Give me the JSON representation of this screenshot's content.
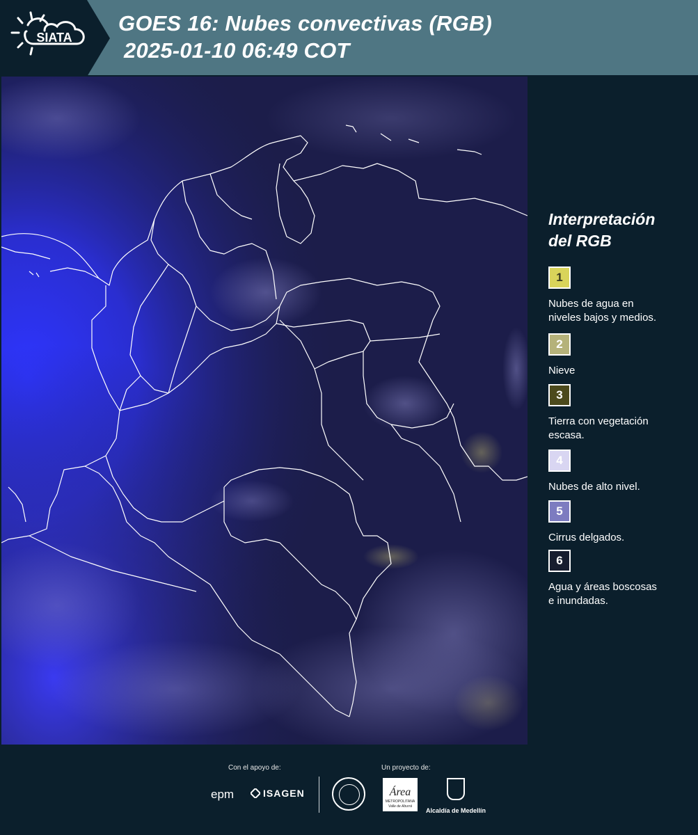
{
  "header": {
    "logo_text": "SIATA",
    "title_line1": "GOES 16: Nubes convectivas (RGB)",
    "title_line2": "2025-01-10 06:49 COT",
    "band_color": "#4f7683",
    "logo_bg_color": "#0b1f2c"
  },
  "legend": {
    "title_line1": "Interpretación",
    "title_line2": "del RGB",
    "items": [
      {
        "number": "1",
        "label_line1": "Nubes de agua en",
        "label_line2": "niveles bajos y medios.",
        "color": "#d9d45a",
        "text_color": "#3a3a20"
      },
      {
        "number": "2",
        "label_line1": "Nieve",
        "label_line2": "",
        "color": "#b5b27a",
        "text_color": "#ffffff"
      },
      {
        "number": "3",
        "label_line1": "Tierra con vegetación",
        "label_line2": "escasa.",
        "color": "#4c4a1c",
        "text_color": "#ffffff"
      },
      {
        "number": "4",
        "label_line1": "Nubes de alto nivel.",
        "label_line2": "",
        "color": "#d9d6f2",
        "text_color": "#ffffff"
      },
      {
        "number": "5",
        "label_line1": "Cirrus delgados.",
        "label_line2": "",
        "color": "#7d7cc0",
        "text_color": "#ffffff"
      },
      {
        "number": "6",
        "label_line1": "Agua y áreas boscosas",
        "label_line2": "e inundadas.",
        "color": "#171d2f",
        "text_color": "#ffffff"
      }
    ]
  },
  "footer": {
    "support_caption": "Con el apoyo de:",
    "project_caption": "Un proyecto de:",
    "sponsor1": "epm",
    "sponsor2": "ISAGEN",
    "partner_area_name": "Área",
    "partner_area_sub1": "METROPOLITANA",
    "partner_area_sub2": "Valle de Aburrá",
    "partner_alcaldia": "Alcaldía de Medellín"
  },
  "map": {
    "ocean_color": "#1c1d4a",
    "pacific_color": "#2a2ee8",
    "border_color": "#ffffff"
  }
}
